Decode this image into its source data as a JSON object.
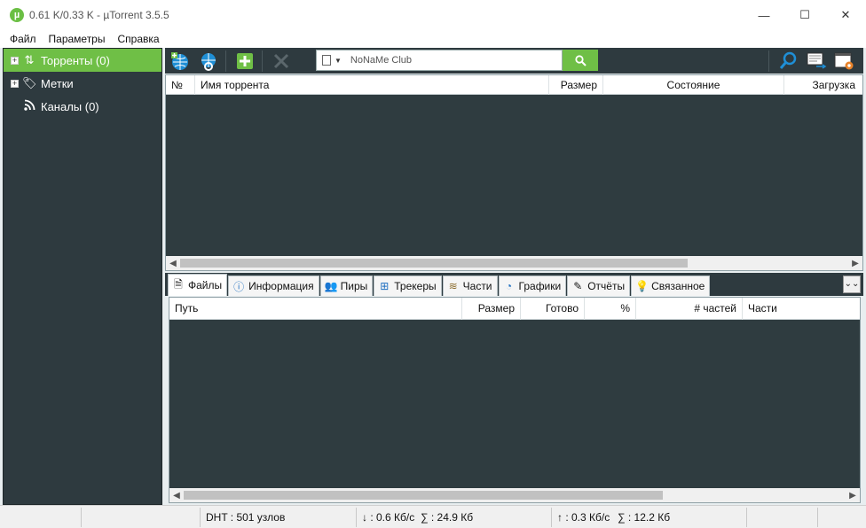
{
  "window": {
    "title": "0.61 K/0.33 K - µTorrent 3.5.5",
    "minimize": "—",
    "maximize": "☐",
    "close": "✕"
  },
  "menu": [
    "Файл",
    "Параметры",
    "Справка"
  ],
  "sidebar": {
    "items": [
      {
        "label": "Торренты (0)",
        "icon": "torrents-icon",
        "glyph": "⇅",
        "expander": "+",
        "active": true
      },
      {
        "label": "Метки",
        "icon": "tag-icon",
        "glyph": "🏷",
        "expander": "+",
        "active": false
      },
      {
        "label": "Каналы (0)",
        "icon": "rss-icon",
        "glyph": "◥",
        "expander": "",
        "active": false
      }
    ]
  },
  "toolbar": {
    "search_value": "NoNaMe Club",
    "buttons": [
      "add-url-icon",
      "create-torrent-icon",
      "add-torrent-icon",
      "remove-icon"
    ],
    "right_buttons": [
      "find-icon",
      "remote-icon",
      "settings-icon"
    ]
  },
  "torrent_list": {
    "columns": [
      "№",
      "Имя торрента",
      "Размер",
      "Состояние",
      "Загрузка"
    ]
  },
  "tabs": [
    {
      "label": "Файлы",
      "icon": "files-icon",
      "glyph": "🗎",
      "active": true
    },
    {
      "label": "Информация",
      "icon": "info-icon",
      "glyph": "ⓘ",
      "active": false
    },
    {
      "label": "Пиры",
      "icon": "peers-icon",
      "glyph": "👥",
      "active": false
    },
    {
      "label": "Трекеры",
      "icon": "trackers-icon",
      "glyph": "⊞",
      "active": false
    },
    {
      "label": "Части",
      "icon": "pieces-icon",
      "glyph": "≋",
      "active": false
    },
    {
      "label": "Графики",
      "icon": "graphs-icon",
      "glyph": "◔",
      "active": false
    },
    {
      "label": "Отчёты",
      "icon": "logger-icon",
      "glyph": "✎",
      "active": false
    },
    {
      "label": "Связанное",
      "icon": "related-icon",
      "glyph": "💡",
      "active": false
    }
  ],
  "files_list": {
    "columns": [
      "Путь",
      "Размер",
      "Готово",
      "%",
      "# частей",
      "Части"
    ]
  },
  "status": {
    "dht": "DHT : 501 узлов",
    "down_speed": "↓ : 0.6 Кб/с",
    "down_total": "∑ : 24.9 Кб",
    "up_speed": "↑ : 0.3 Кб/с",
    "up_total": "∑ : 12.2 Кб"
  },
  "colors": {
    "accent": "#6fbf46",
    "panel": "#2e3a3f"
  }
}
